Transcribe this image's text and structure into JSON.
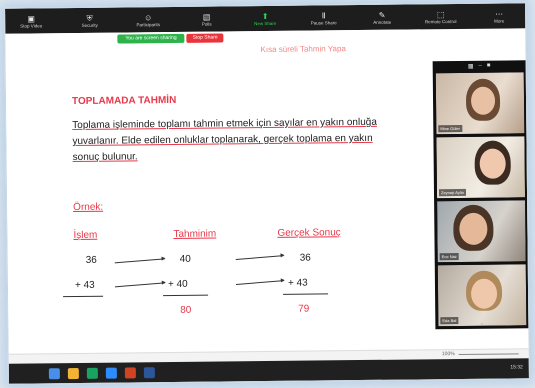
{
  "toolbar": {
    "items": [
      {
        "name": "stop-video-button",
        "label": "Stop Video",
        "icon": "video-camera-icon"
      },
      {
        "name": "security-button",
        "label": "Security",
        "icon": "shield-icon"
      },
      {
        "name": "participants-button",
        "label": "Participants",
        "icon": "people-icon"
      },
      {
        "name": "polls-button",
        "label": "Polls",
        "icon": "poll-icon"
      },
      {
        "name": "new-share-button",
        "label": "New Share",
        "icon": "share-screen-icon",
        "accent": "#2fce5a"
      },
      {
        "name": "pause-share-button",
        "label": "Pause Share",
        "icon": "pause-icon"
      },
      {
        "name": "annotate-button",
        "label": "Annotate",
        "icon": "pencil-icon"
      },
      {
        "name": "remote-control-button",
        "label": "Remote Control",
        "icon": "mouse-icon"
      },
      {
        "name": "more-button",
        "label": "More",
        "icon": "more-icon"
      }
    ],
    "banner": {
      "status": "You are screen sharing",
      "stop_label": "Stop Share"
    }
  },
  "slide": {
    "faded_top": "Kısa süreli Tahmin Yapa",
    "title": "TOPLAMADA TAHMİN",
    "paragraph": "Toplama işleminde toplamı tahmin etmek için sayılar en yakın onluğa yuvarlanır. Elde edilen onluklar toplanarak, gerçek toplama en yakın sonuç bulunur.",
    "example_label": "Örnek:",
    "headers": {
      "islem": "İşlem",
      "tahminim": "Tahminim",
      "gercek": "Gerçek Sonuç"
    },
    "rows": {
      "islem_1": "36",
      "islem_2": "+ 43",
      "tahmin_1": "40",
      "tahmin_2": "+ 40",
      "tahmin_result": "80",
      "gercek_1": "36",
      "gercek_2": "+ 43",
      "gercek_result": "79"
    }
  },
  "participants": {
    "header_icons": [
      "grid-icon",
      "minimize-icon",
      "close-icon"
    ],
    "tiles": [
      {
        "name": "Mine Güler"
      },
      {
        "name": "Zeynep Aylin"
      },
      {
        "name": "Ece Naz"
      },
      {
        "name": "Eda Bal"
      }
    ]
  },
  "status": {
    "zoom": "100%"
  },
  "taskbar": {
    "time": "15:32"
  },
  "colors": {
    "accent_red": "#e8394a",
    "toolbar": "#1d1d1d",
    "share_green": "#2db34a",
    "stop_red": "#e8343a"
  }
}
